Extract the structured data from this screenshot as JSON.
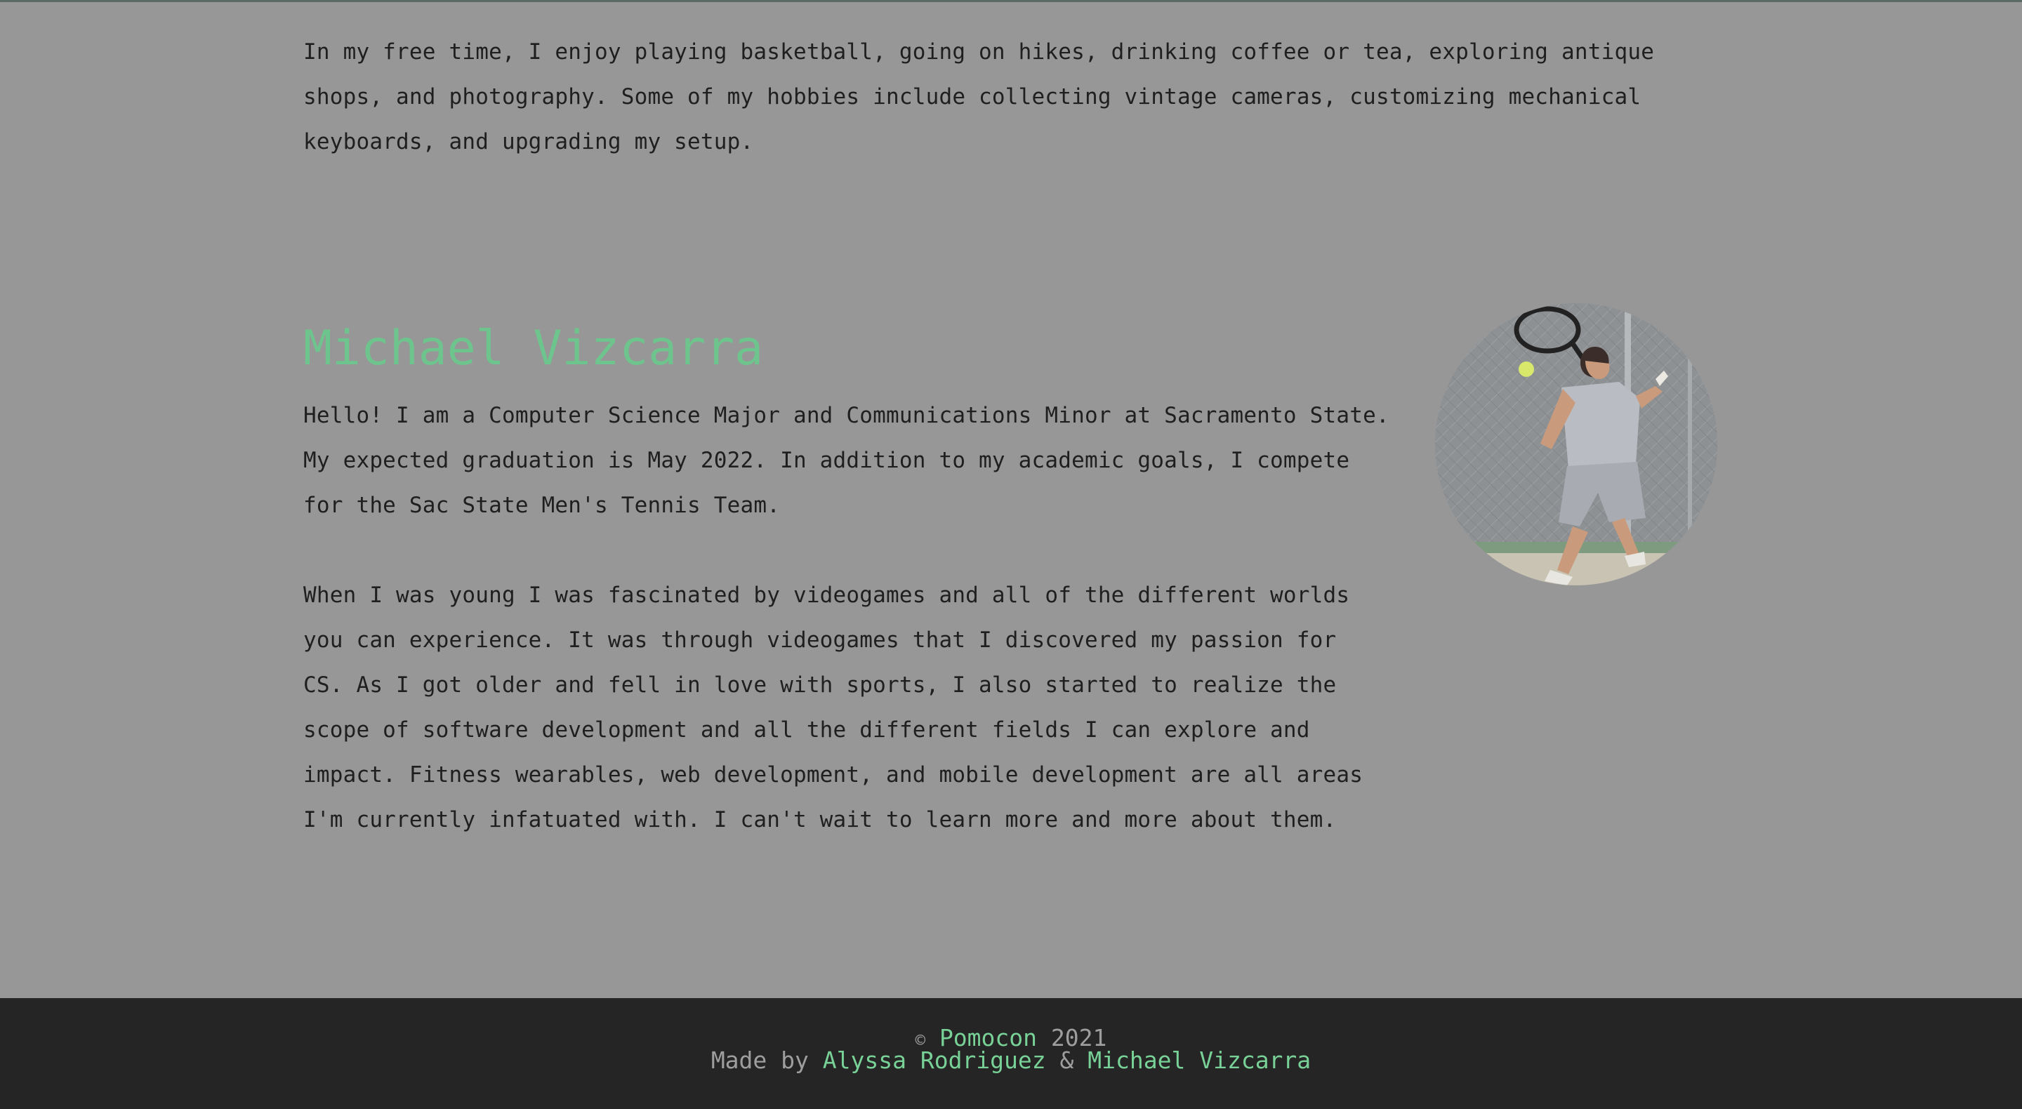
{
  "about": {
    "intro_text": "In my free time, I enjoy playing basketball, going on hikes, drinking coffee or tea, exploring antique shops, and photography. Some of my hobbies include collecting vintage cameras, customizing mechanical keyboards, and upgrading my setup."
  },
  "profile": {
    "name": "Michael Vizcarra",
    "bio_paragraph_1": "Hello! I am a Computer Science Major and Communications Minor at Sacramento State. My expected graduation is May 2022. In addition to my academic goals, I compete for the Sac State Men's Tennis Team.",
    "bio_paragraph_2": "When I was young I was fascinated by videogames and all of the different worlds you can experience. It was through videogames that I discovered my passion for CS. As I got older and fell in love with sports, I also started to realize the scope of software development and all the different fields I can explore and impact. Fitness wearables, web development, and mobile development are all areas I'm currently infatuated with. I can't wait to learn more and more about them."
  },
  "footer": {
    "copyright_symbol": "©",
    "brand": "Pomocon",
    "year": "2021",
    "made_by_label": "Made by",
    "author_1": "Alyssa Rodriguez",
    "separator": "&",
    "author_2": "Michael Vizcarra"
  },
  "colors": {
    "background": "#979797",
    "accent": "#6ec48d",
    "footer_background": "#252525",
    "footer_text": "#9e9e9e",
    "link": "#78d196"
  }
}
